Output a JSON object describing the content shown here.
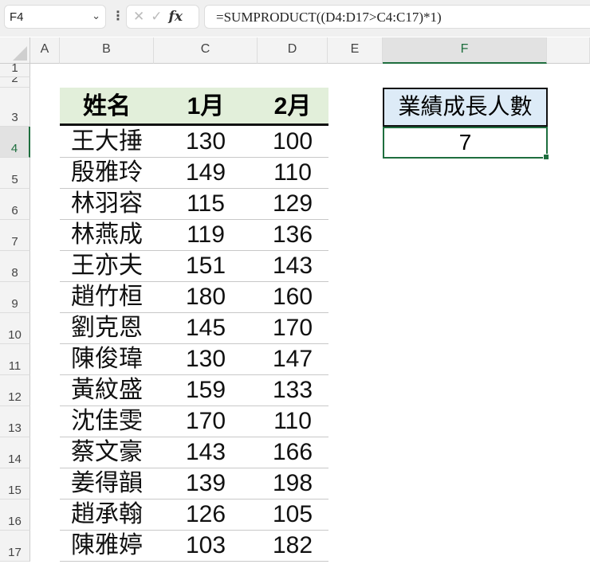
{
  "namebox": "F4",
  "formula": "=SUMPRODUCT((D4:D17>C4:C17)*1)",
  "columns": [
    "A",
    "B",
    "C",
    "D",
    "E",
    "F"
  ],
  "rows": [
    "1",
    "2",
    "3",
    "4",
    "5",
    "6",
    "7",
    "8",
    "9",
    "10",
    "11",
    "12",
    "13",
    "14",
    "15",
    "16",
    "17"
  ],
  "table": {
    "headers": [
      "姓名",
      "1月",
      "2月"
    ],
    "data": [
      [
        "王大捶",
        "130",
        "100"
      ],
      [
        "殷雅玲",
        "149",
        "110"
      ],
      [
        "林羽容",
        "115",
        "129"
      ],
      [
        "林燕成",
        "119",
        "136"
      ],
      [
        "王亦夫",
        "151",
        "143"
      ],
      [
        "趙竹桓",
        "180",
        "160"
      ],
      [
        "劉克恩",
        "145",
        "170"
      ],
      [
        "陳俊瑋",
        "130",
        "147"
      ],
      [
        "黃紋盛",
        "159",
        "133"
      ],
      [
        "沈佳雯",
        "170",
        "110"
      ],
      [
        "蔡文豪",
        "143",
        "166"
      ],
      [
        "姜得韻",
        "139",
        "198"
      ],
      [
        "趙承翰",
        "126",
        "105"
      ],
      [
        "陳雅婷",
        "103",
        "182"
      ]
    ]
  },
  "summary": {
    "label": "業績成長人數",
    "value": "7"
  }
}
